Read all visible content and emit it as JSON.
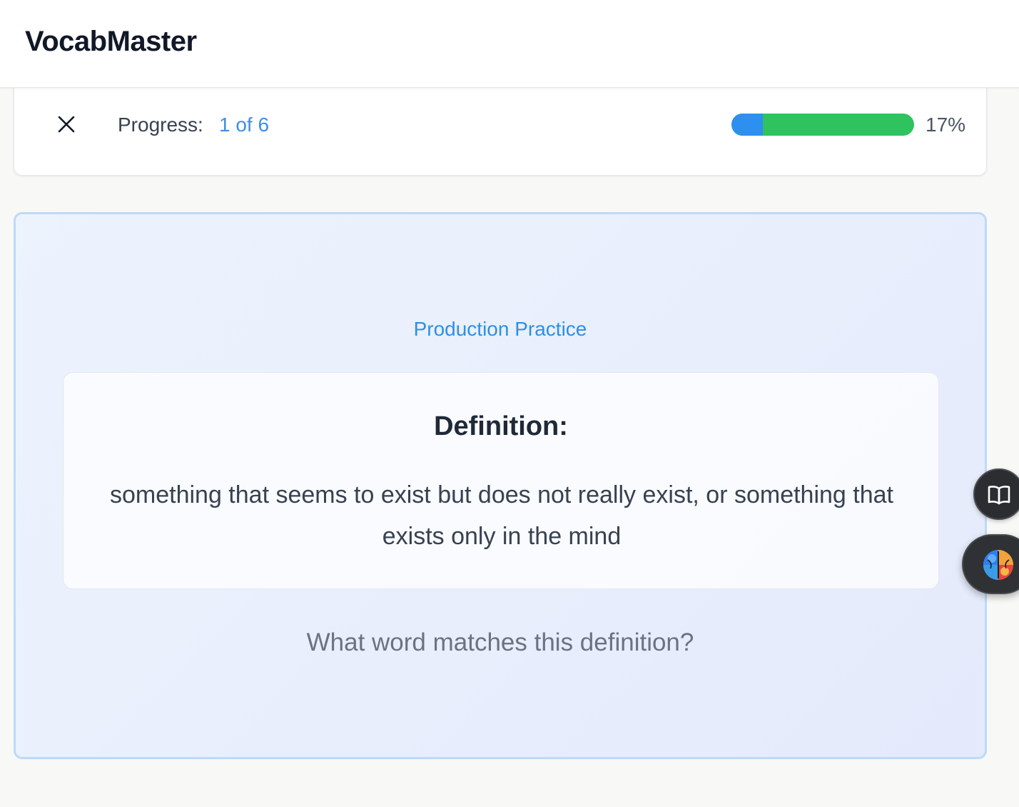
{
  "header": {
    "app_title": "VocabMaster"
  },
  "progress": {
    "close_icon": "close-icon",
    "label": "Progress:",
    "count": "1 of 6",
    "fraction": 0.17,
    "percent_text": "17%",
    "fill_color": "#2d8ff0",
    "track_color": "#2fc35f"
  },
  "practice": {
    "mode_label": "Production Practice",
    "definition_heading": "Definition:",
    "definition_text": "something that seems to exist but does not really exist, or something that exists only in the mind",
    "question": "What word matches this definition?"
  },
  "floating_buttons": {
    "dictionary_icon": "book-open-icon",
    "assistant_icon": "brain-icon"
  },
  "colors": {
    "accent": "#2e90e3",
    "card_border": "#bcdaf8"
  }
}
